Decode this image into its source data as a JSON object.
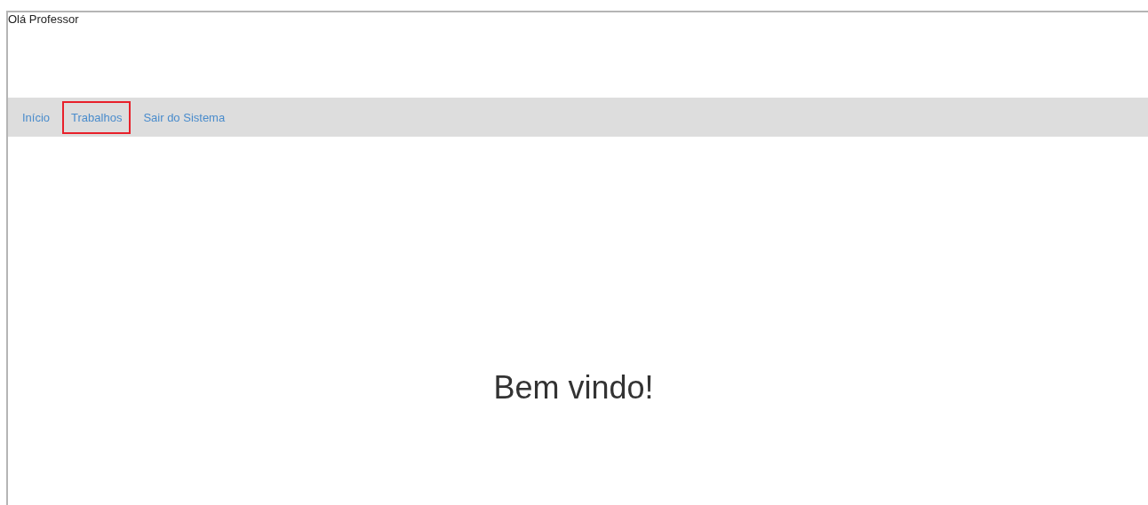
{
  "greeting": "Olá Professor",
  "nav": [
    {
      "label": "Início",
      "highlighted": false
    },
    {
      "label": "Trabalhos",
      "highlighted": true
    },
    {
      "label": "Sair do Sistema",
      "highlighted": false
    }
  ],
  "heading": "Bem vindo!"
}
